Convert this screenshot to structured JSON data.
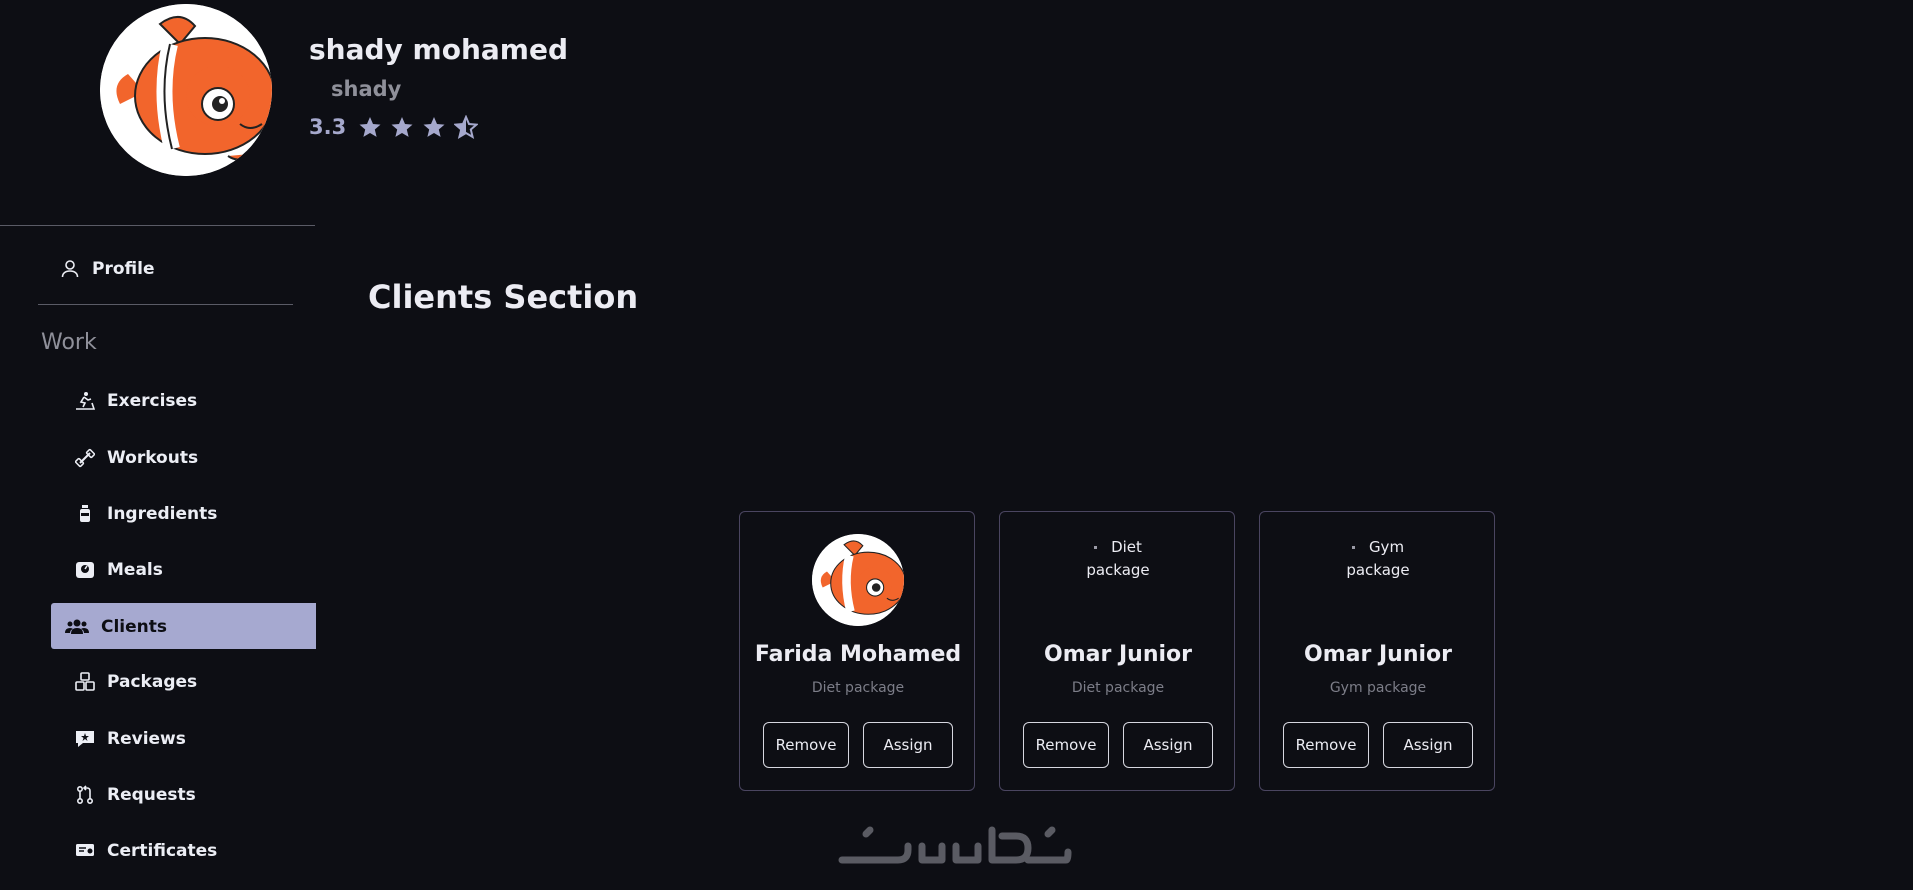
{
  "profile": {
    "name": "shady mohamed",
    "username": "shady",
    "rating": "3.3",
    "stars_filled": 3,
    "stars_half": 1,
    "stars_total": 4,
    "avatar_icon": "clownfish-avatar"
  },
  "sidebar": {
    "profile_label": "Profile",
    "work_heading": "Work",
    "items": [
      {
        "label": "Exercises",
        "icon": "treadmill-icon"
      },
      {
        "label": "Workouts",
        "icon": "dumbbell-icon"
      },
      {
        "label": "Ingredients",
        "icon": "bottle-icon"
      },
      {
        "label": "Meals",
        "icon": "scale-icon"
      },
      {
        "label": "Clients",
        "icon": "users-icon",
        "active": true
      },
      {
        "label": "Packages",
        "icon": "boxes-icon"
      },
      {
        "label": "Reviews",
        "icon": "review-icon"
      },
      {
        "label": "Requests",
        "icon": "pull-request-icon"
      },
      {
        "label": "Certificates",
        "icon": "certificate-icon"
      }
    ]
  },
  "main": {
    "title": "Clients Section",
    "clients": [
      {
        "name": "Farida Mohamed",
        "package": "Diet package",
        "image": "avatar",
        "remove_label": "Remove",
        "assign_label": "Assign"
      },
      {
        "name": "Omar Junior",
        "package": "Diet package",
        "image_alt_line1": "Diet",
        "image_alt_line2": "package",
        "remove_label": "Remove",
        "assign_label": "Assign"
      },
      {
        "name": "Omar Junior",
        "package": "Gym package",
        "image_alt_line1": "Gym",
        "image_alt_line2": "package",
        "remove_label": "Remove",
        "assign_label": "Assign"
      }
    ]
  },
  "colors": {
    "background": "#0d0e14",
    "accent": "#a6a9d0",
    "card_border": "#4a4560",
    "muted_text": "#8f909a"
  }
}
